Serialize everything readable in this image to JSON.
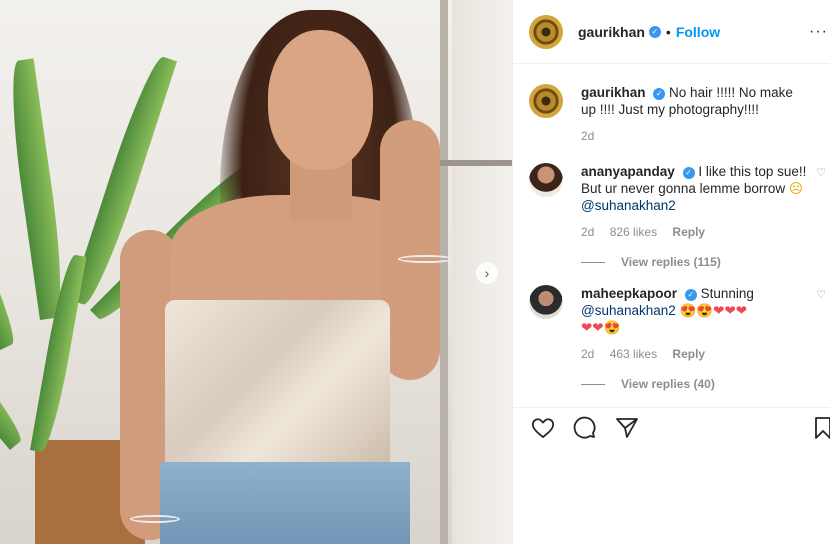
{
  "post": {
    "author": "gaurikhan",
    "follow_label": "Follow",
    "separator": "•",
    "more_label": "···",
    "next_label": "›"
  },
  "comments": [
    {
      "user": "gaurikhan",
      "text": "No hair !!!!! No make up !!!! Just my photography!!!!",
      "time": "2d"
    },
    {
      "user": "ananyapanday",
      "text": "I like this top sue!! But ur never gonna lemme borrow",
      "emoji": "☹",
      "mention": "@suhanakhan2",
      "time": "2d",
      "likes": "826 likes",
      "reply_label": "Reply",
      "view_replies": "View replies (115)"
    },
    {
      "user": "maheepkapoor",
      "text": "Stunning",
      "mention": "@suhanakhan2",
      "emojis_line1": "😍😍❤❤❤",
      "emojis_line2": "❤❤😍",
      "time": "2d",
      "likes": "463 likes",
      "reply_label": "Reply",
      "view_replies": "View replies (40)"
    }
  ],
  "icons": [
    "heart-icon",
    "comment-icon",
    "share-icon",
    "bookmark-icon",
    "verified-icon",
    "more-icon",
    "chevron-right-icon"
  ],
  "colors": {
    "link": "#0095f6",
    "verified": "#3897f0",
    "mention": "#00376b",
    "heart": "#ed4956"
  }
}
